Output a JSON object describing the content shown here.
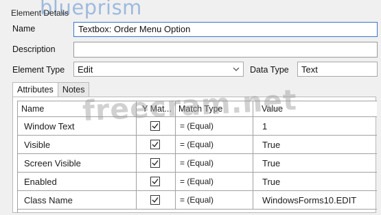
{
  "brand": "blueprism",
  "section_title": "Element Details",
  "fields": {
    "name_label": "Name",
    "name_value": "Textbox: Order Menu Option",
    "description_label": "Description",
    "description_value": "",
    "element_type_label": "Element Type",
    "element_type_value": "Edit",
    "data_type_label": "Data Type",
    "data_type_value": "Text"
  },
  "tabs": [
    {
      "label": "Attributes",
      "active": true
    },
    {
      "label": "Notes",
      "active": false
    }
  ],
  "grid": {
    "columns": [
      "Name",
      "Y Mat...",
      "Match Type",
      "Value"
    ],
    "rows": [
      {
        "name": "Window Text",
        "checked": true,
        "match_type": "=  (Equal)",
        "value": "1"
      },
      {
        "name": "Visible",
        "checked": true,
        "match_type": "=  (Equal)",
        "value": "True"
      },
      {
        "name": "Screen Visible",
        "checked": true,
        "match_type": "=  (Equal)",
        "value": "True"
      },
      {
        "name": "Enabled",
        "checked": true,
        "match_type": "=  (Equal)",
        "value": "True"
      },
      {
        "name": "Class Name",
        "checked": true,
        "match_type": "=  (Equal)",
        "value": "WindowsForms10.EDIT"
      }
    ]
  },
  "watermark": "freecram.net",
  "colors": {
    "brand": "#5b8fd1",
    "focus_border": "#3a74c9",
    "grid_line": "#a0a0a0"
  },
  "icons": {
    "dropdown": "chevron-down-icon",
    "checkbox": "checkbox-checked-icon"
  }
}
